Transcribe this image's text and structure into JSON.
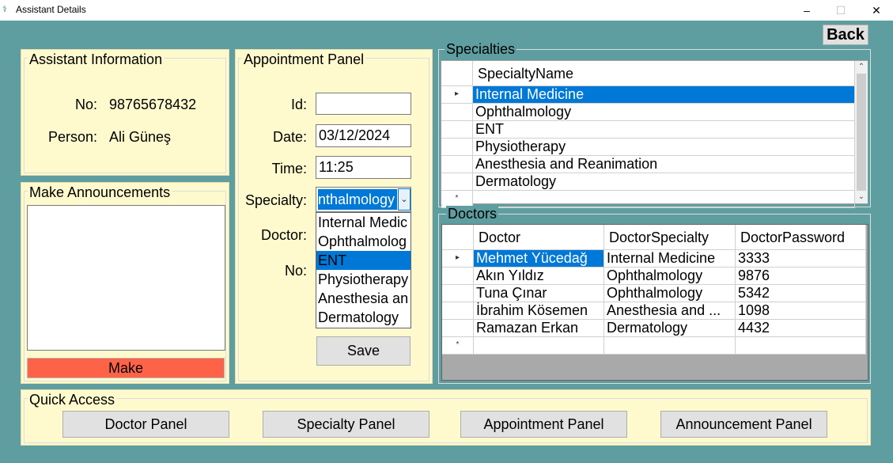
{
  "window": {
    "title": "Assistant Details",
    "app_icon": "stethoscope-icon",
    "minimize_glyph": "–",
    "maximize_glyph": "☐",
    "close_glyph": "✕"
  },
  "back_label": "Back",
  "assistant_info": {
    "title": "Assistant Information",
    "no_label": "No:",
    "no_value": "98765678432",
    "person_label": "Person:",
    "person_value": "Ali Güneş"
  },
  "announcements": {
    "title": "Make Announcements",
    "text": "",
    "make_label": "Make",
    "make_color": "#ff6347"
  },
  "appointment": {
    "title": "Appointment Panel",
    "id_label": "Id:",
    "id_value": "",
    "date_label": "Date:",
    "date_value": "03/12/2024",
    "time_label": "Time:",
    "time_value": "11:25",
    "specialty_label": "Specialty:",
    "specialty_value": "nthalmology",
    "doctor_label": "Doctor:",
    "no_label": "No:",
    "save_label": "Save",
    "dropdown_options": [
      "Internal Medic",
      "Ophthalmolog",
      "ENT",
      "Physiotherapy",
      "Anesthesia an",
      "Dermatology"
    ],
    "dropdown_selected_index": 2
  },
  "specialties": {
    "title": "Specialties",
    "column": "SpecialtyName",
    "rows": [
      "Internal Medicine",
      "Ophthalmology",
      "ENT",
      "Physiotherapy",
      "Anesthesia and Reanimation",
      "Dermatology"
    ],
    "selected_row": 0,
    "current_row_marker": "▸",
    "new_row_marker": "*"
  },
  "doctors": {
    "title": "Doctors",
    "columns": [
      "Doctor",
      "DoctorSpecialty",
      "DoctorPassword"
    ],
    "rows": [
      [
        "Mehmet Yücedağ",
        "Internal Medicine",
        "3333"
      ],
      [
        "Akın Yıldız",
        "Ophthalmology",
        "9876"
      ],
      [
        "Tuna Çınar",
        "Ophthalmology",
        "5342"
      ],
      [
        "İbrahim Kösemen",
        "Anesthesia and ...",
        "1098"
      ],
      [
        "Ramazan Erkan",
        "Dermatology",
        "4432"
      ]
    ],
    "selected_row": 0,
    "current_row_marker": "▸",
    "new_row_marker": "*"
  },
  "quick_access": {
    "title": "Quick Access",
    "buttons": [
      "Doctor Panel",
      "Specialty Panel",
      "Appointment Panel",
      "Announcement Panel"
    ]
  },
  "colors": {
    "background": "#5f9ea0",
    "panel": "#fffacd",
    "selection": "#0078d7"
  }
}
